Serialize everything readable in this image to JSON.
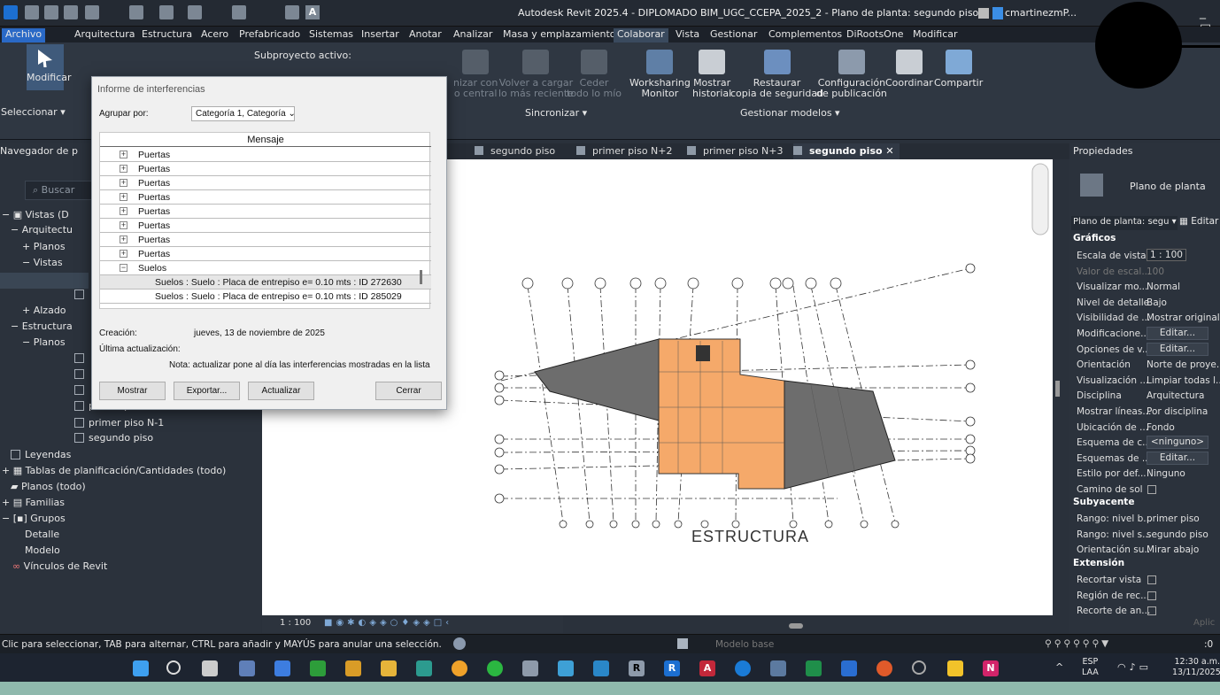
{
  "app": {
    "title": "Autodesk Revit 2025.4 - DIPLOMADO BIM_UGC_CCEPA_2025_2 - Plano de planta: segundo piso",
    "user": "cmartinezmP..."
  },
  "tabs": [
    "Archivo",
    "Arquitectura",
    "Estructura",
    "Acero",
    "Prefabricado",
    "Sistemas",
    "Insertar",
    "Anotar",
    "Analizar",
    "Masa y emplazamiento",
    "Colaborar",
    "Vista",
    "Gestionar",
    "Complementos",
    "DiRootsOne",
    "Modificar"
  ],
  "ribbon": {
    "modify": "Modificar",
    "select": "Seleccionar",
    "subproject_label": "Subproyecto activo:",
    "sync_partial": [
      "nizar con",
      "o central"
    ],
    "reload": [
      "Volver a cargar",
      "lo más reciente"
    ],
    "relinquish": [
      "Ceder",
      "todo lo mío"
    ],
    "worksharing": [
      "Worksharing",
      "Monitor"
    ],
    "history": [
      "Mostrar",
      "historial"
    ],
    "restore": [
      "Restaurar",
      "copia de seguridad"
    ],
    "publish": [
      "Configuración",
      "de publicación"
    ],
    "coordinate": "Coordinar",
    "share": "Compartir",
    "panel_sync": "Sincronizar ▾",
    "panel_manage": "Gestionar modelos ▾"
  },
  "browser": {
    "title": "Navegador de p",
    "search": "Buscar",
    "items": [
      "Vistas (D",
      "Arquitectu",
      "Planos",
      "Vistas",
      "Alzado",
      "Estructura",
      "Planos",
      "primer piso N-3",
      "primer piso N-1",
      "segundo piso",
      "Leyendas",
      "Tablas de planificación/Cantidades (todo)",
      "Planos (todo)",
      "Familias",
      "Grupos",
      "Detalle",
      "Modelo",
      "Vínculos de Revit"
    ]
  },
  "view_tabs": [
    "segundo piso",
    "primer piso N+2",
    "primer piso N+3",
    "segundo piso"
  ],
  "canvas": {
    "label": "ESTRUCTURA",
    "scale": "1 : 100"
  },
  "properties": {
    "title": "Propiedades",
    "type": "Plano de planta",
    "selector": "Plano de planta: segu",
    "edit_type": "Editar",
    "sections": {
      "graphics": "Gráficos",
      "underlay": "Subyacente",
      "extent": "Extensión"
    },
    "rows": [
      [
        "Escala de vista",
        "1 : 100"
      ],
      [
        "Valor de escal...",
        "100"
      ],
      [
        "Visualizar mo...",
        "Normal"
      ],
      [
        "Nivel de detalle",
        "Bajo"
      ],
      [
        "Visibilidad de ...",
        "Mostrar original"
      ],
      [
        "Modificacione...",
        "Editar..."
      ],
      [
        "Opciones de v...",
        "Editar..."
      ],
      [
        "Orientación",
        "Norte de proye..."
      ],
      [
        "Visualización ...",
        "Limpiar todas l..."
      ],
      [
        "Disciplina",
        "Arquitectura"
      ],
      [
        "Mostrar líneas...",
        "Por disciplina"
      ],
      [
        "Ubicación de ...",
        "Fondo"
      ],
      [
        "Esquema de c...",
        "<ninguno>"
      ],
      [
        "Esquemas de ...",
        "Editar..."
      ],
      [
        "Estilo por def...",
        "Ninguno"
      ],
      [
        "Camino de sol",
        ""
      ]
    ],
    "underlay_rows": [
      [
        "Rango: nivel b...",
        "primer piso"
      ],
      [
        "Rango: nivel s...",
        "segundo piso"
      ],
      [
        "Orientación su...",
        "Mirar abajo"
      ]
    ],
    "extent_rows": [
      [
        "Recortar vista",
        ""
      ],
      [
        "Región de rec...",
        ""
      ],
      [
        "Recorte de an...",
        ""
      ]
    ],
    "apply": "Aplic"
  },
  "status": {
    "hint": "Clic para seleccionar, TAB para alternar, CTRL para añadir y MAYÚS para anular una selección.",
    "model": "Modelo base",
    "count": ":0"
  },
  "taskbar": {
    "lang": "ESP",
    "lang2": "LAA",
    "time": "12:30 a.m.",
    "date": "13/11/2025"
  },
  "dialog": {
    "title": "Informe de interferencias",
    "group_label": "Agrupar por:",
    "group_value": "Categoría 1, Categoría",
    "header": "Mensaje",
    "rows": [
      "Puertas",
      "Puertas",
      "Puertas",
      "Puertas",
      "Puertas",
      "Puertas",
      "Puertas",
      "Puertas",
      "Suelos",
      "Suelos : Suelo : Placa de entrepiso e= 0.10 mts : ID 272630",
      "Suelos : Suelo : Placa de entrepiso e= 0.10 mts : ID 285029"
    ],
    "created_label": "Creación:",
    "created_value": "jueves, 13 de noviembre de 2025",
    "updated_label": "Última actualización:",
    "note": "Nota: actualizar pone al día las interferencias mostradas en la lista",
    "buttons": {
      "show": "Mostrar",
      "export": "Exportar...",
      "update": "Actualizar",
      "close": "Cerrar"
    }
  },
  "colors": {
    "orange": "#f5a96a",
    "gray": "#6d6d6d"
  }
}
